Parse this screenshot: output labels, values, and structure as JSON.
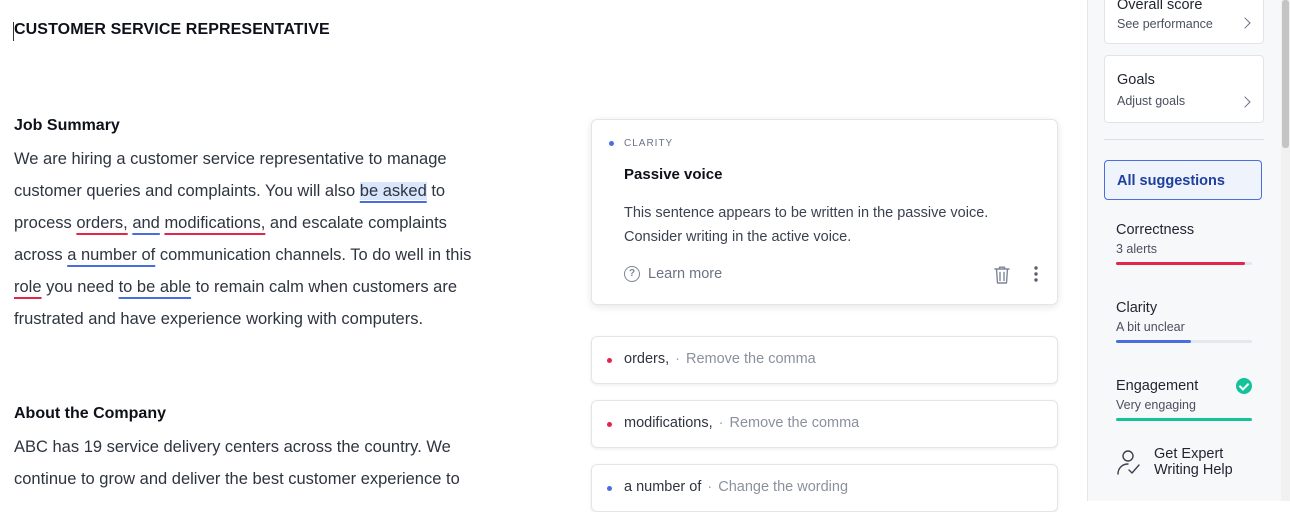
{
  "document": {
    "title": "CUSTOMER SERVICE REPRESENTATIVE",
    "job_summary": {
      "heading": "Job Summary",
      "lines": [
        [
          "We are hiring a customer service representative to manage"
        ],
        [
          "customer queries and complaints. You will also ",
          "be asked",
          " to"
        ],
        [
          "process ",
          "orders,",
          " ",
          "and",
          " ",
          "modifications,",
          " and escalate complaints"
        ],
        [
          "across ",
          "a number of",
          " communication channels. To do well in this"
        ],
        [
          "role",
          " you need ",
          "to be able",
          " to remain calm when customers are"
        ],
        [
          "frustrated and have experience working with computers."
        ]
      ]
    },
    "about": {
      "heading": "About the Company",
      "lines": [
        "ABC has 19 service delivery centers across the country. We",
        "continue to grow and deliver the best customer experience to"
      ]
    }
  },
  "suggestion_card": {
    "category": "CLARITY",
    "title": "Passive voice",
    "description_line1": "This sentence appears to be written in the passive voice.",
    "description_line2": "Consider writing in the active voice.",
    "learn_more": "Learn more",
    "learn_icon": "question-circle-icon",
    "delete_icon": "trash-icon",
    "more_icon": "more-vertical-icon"
  },
  "mini_cards": [
    {
      "word": "orders,",
      "sep": "·",
      "action": "Remove the comma",
      "color": "#e2254a"
    },
    {
      "word": "modifications,",
      "sep": "·",
      "action": "Remove the comma",
      "color": "#e2254a"
    },
    {
      "word": "a number of",
      "sep": "·",
      "action": "Change the wording",
      "color": "#4a6ee0"
    }
  ],
  "sidebar": {
    "overall": {
      "title": "Overall score",
      "subtitle": "See performance"
    },
    "goals": {
      "title": "Goals",
      "subtitle": "Adjust goals"
    },
    "all_suggestions": "All suggestions",
    "categories": [
      {
        "name": "Correctness",
        "value": "3 alerts",
        "color": "#e2254a",
        "fill": 0.95
      },
      {
        "name": "Clarity",
        "value": "A bit unclear",
        "color": "#4a6ee0",
        "fill": 0.55
      },
      {
        "name": "Engagement",
        "value": "Very engaging",
        "color": "#15c39a",
        "fill": 1.0
      }
    ],
    "expert": {
      "line1": "Get Expert",
      "line2": "Writing Help",
      "icon": "person-check-icon"
    }
  },
  "colors": {
    "correctness": "#e2254a",
    "clarity": "#4a6ee0",
    "engagement": "#15c39a"
  }
}
